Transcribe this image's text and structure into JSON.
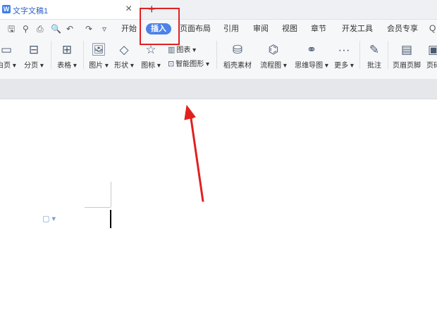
{
  "tab": {
    "logo": "W",
    "title": "文字文稿1",
    "close": "×"
  },
  "new_tab": "+",
  "quick_access": [
    {
      "name": "save-icon",
      "glyph": "🖫"
    },
    {
      "name": "format-painter-icon",
      "glyph": "⚲"
    },
    {
      "name": "print-icon",
      "glyph": "⎙"
    },
    {
      "name": "print-preview-icon",
      "glyph": "🔍"
    },
    {
      "name": "undo-icon",
      "glyph": "↶"
    },
    {
      "name": "redo-icon",
      "glyph": "↷"
    },
    {
      "name": "more-dropdown-icon",
      "glyph": "▿"
    }
  ],
  "menu": [
    "开始",
    "插入",
    "页面布局",
    "引用",
    "审阅",
    "视图",
    "章节",
    "开发工具",
    "会员专享"
  ],
  "active_menu": "插入",
  "search_icon": "Q",
  "tools": [
    {
      "label": "白页 ▾",
      "icon": "blank-page-icon",
      "glyph": "▭"
    },
    {
      "label": "分页 ▾",
      "icon": "page-break-icon",
      "glyph": "⊟"
    },
    {
      "label": "表格 ▾",
      "icon": "table-icon",
      "glyph": "⊞"
    },
    {
      "label": "图片 ▾",
      "icon": "picture-icon",
      "glyph": "🖼"
    },
    {
      "label": "形状 ▾",
      "icon": "shape-icon",
      "glyph": "◇"
    },
    {
      "label": "图标 ▾",
      "icon": "icon-library-icon",
      "glyph": "☆"
    },
    {
      "label": "稻壳素材",
      "icon": "docer-material-icon",
      "glyph": "⛁"
    },
    {
      "label": "流程图 ▾",
      "icon": "flowchart-icon",
      "glyph": "⌬"
    },
    {
      "label": "思维导图 ▾",
      "icon": "mindmap-icon",
      "glyph": "⚭"
    },
    {
      "label": "更多 ▾",
      "icon": "more-icon",
      "glyph": "···"
    },
    {
      "label": "批注",
      "icon": "comment-icon",
      "glyph": "✎"
    },
    {
      "label": "页眉页脚",
      "icon": "header-footer-icon",
      "glyph": "▤"
    },
    {
      "label": "页码",
      "icon": "page-number-icon",
      "glyph": "▣"
    }
  ],
  "small_tools": [
    {
      "label": "图表 ▾",
      "icon": "chart-icon",
      "glyph": "▥"
    },
    {
      "label": "智能图形 ▾",
      "icon": "smart-art-icon",
      "glyph": "⊡"
    }
  ],
  "paragraph_marker": "▢ ▾",
  "highlight_color": "#e02020",
  "arrow_color": "#e02020",
  "active_color": "#4c82e9"
}
